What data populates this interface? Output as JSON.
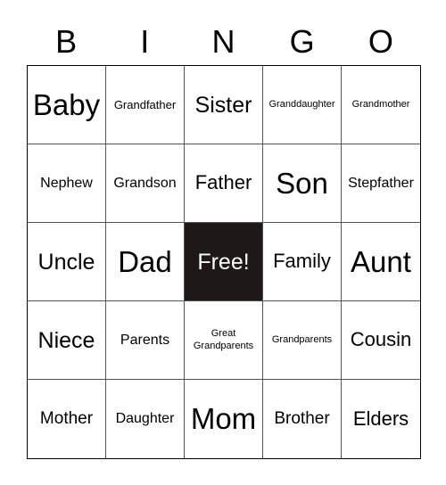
{
  "header": [
    "B",
    "I",
    "N",
    "G",
    "O"
  ],
  "free_color": "#1e1818",
  "cells": [
    "Baby",
    "Grandfather",
    "Sister",
    "Granddaughter",
    "Grandmother",
    "Nephew",
    "Grandson",
    "Father",
    "Son",
    "Stepfather",
    "Uncle",
    "Dad",
    "Free!",
    "Family",
    "Aunt",
    "Niece",
    "Parents",
    "Great Grandparents",
    "Grandparents",
    "Cousin",
    "Mother",
    "Daughter",
    "Mom",
    "Brother",
    "Elders"
  ]
}
